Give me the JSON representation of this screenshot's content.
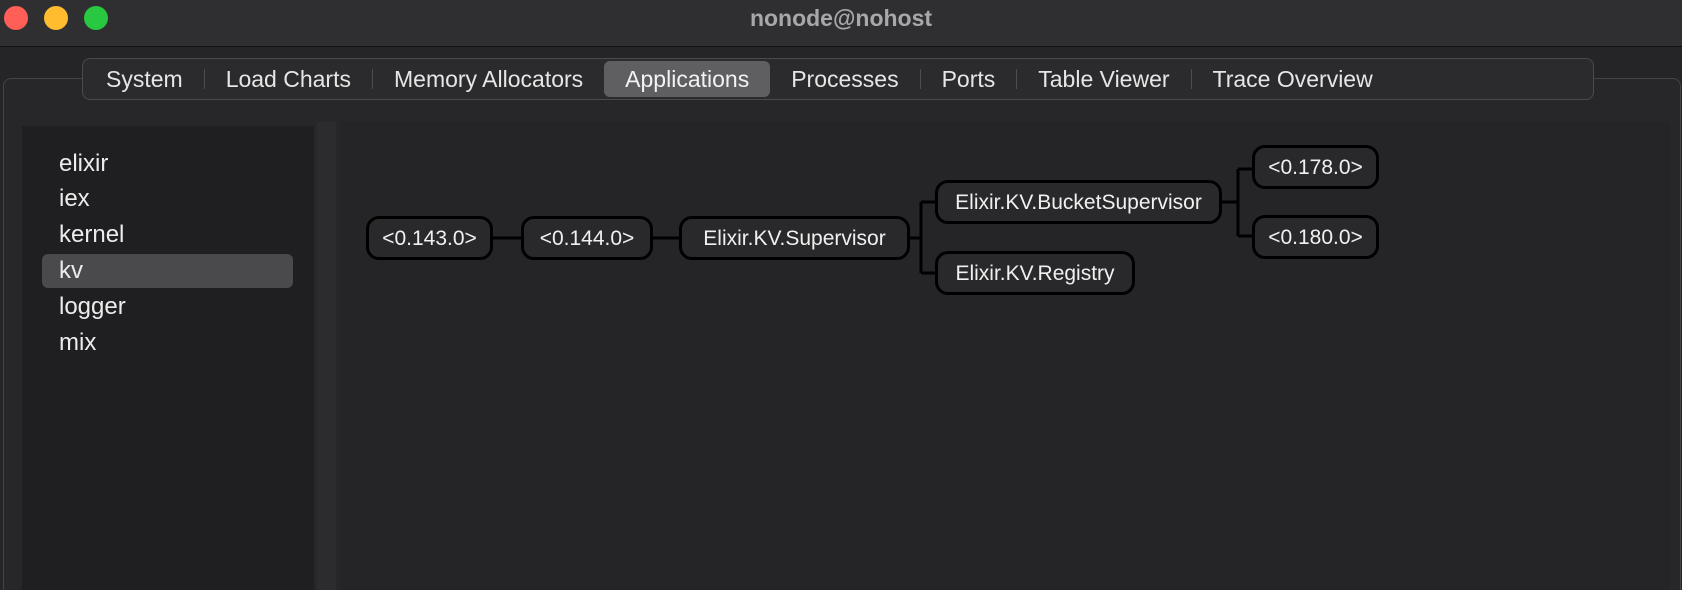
{
  "window": {
    "title": "nonode@nohost"
  },
  "tabs": [
    {
      "label": "System",
      "active": false
    },
    {
      "label": "Load Charts",
      "active": false
    },
    {
      "label": "Memory Allocators",
      "active": false
    },
    {
      "label": "Applications",
      "active": true
    },
    {
      "label": "Processes",
      "active": false
    },
    {
      "label": "Ports",
      "active": false
    },
    {
      "label": "Table Viewer",
      "active": false
    },
    {
      "label": "Trace Overview",
      "active": false
    }
  ],
  "applications": [
    {
      "label": "elixir",
      "selected": false
    },
    {
      "label": "iex",
      "selected": false
    },
    {
      "label": "kernel",
      "selected": false
    },
    {
      "label": "kv",
      "selected": true
    },
    {
      "label": "logger",
      "selected": false
    },
    {
      "label": "mix",
      "selected": false
    }
  ],
  "tree": {
    "nodes": [
      {
        "id": "n143",
        "label": "<0.143.0>"
      },
      {
        "id": "n144",
        "label": "<0.144.0>"
      },
      {
        "id": "sup",
        "label": "Elixir.KV.Supervisor"
      },
      {
        "id": "bucket",
        "label": "Elixir.KV.BucketSupervisor"
      },
      {
        "id": "registry",
        "label": "Elixir.KV.Registry"
      },
      {
        "id": "n178",
        "label": "<0.178.0>"
      },
      {
        "id": "n180",
        "label": "<0.180.0>"
      }
    ],
    "edges": [
      [
        "n143",
        "n144"
      ],
      [
        "n144",
        "sup"
      ],
      [
        "sup",
        "bucket"
      ],
      [
        "sup",
        "registry"
      ],
      [
        "bucket",
        "n178"
      ],
      [
        "bucket",
        "n180"
      ]
    ]
  },
  "colors": {
    "close": "#ff5f57",
    "minimize": "#febc2e",
    "zoom": "#28c840",
    "selection": "#4a4a4d",
    "active_tab": "#5f5f62"
  }
}
